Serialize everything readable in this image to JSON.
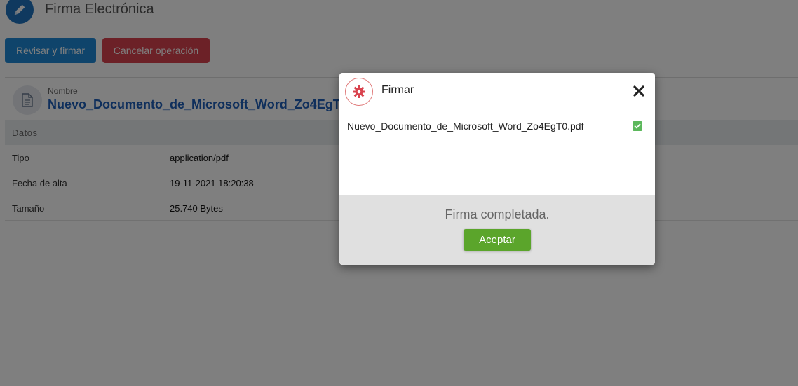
{
  "header": {
    "title": "Firma Electrónica",
    "logo_icon": "pen-icon"
  },
  "toolbar": {
    "review_sign_label": "Revisar y firmar",
    "cancel_label": "Cancelar operación"
  },
  "document": {
    "name_label": "Nombre",
    "name": "Nuevo_Documento_de_Microsoft_Word_Zo4EgT0.pdf",
    "section_title": "Datos",
    "rows": [
      {
        "key": "Tipo",
        "value": "application/pdf"
      },
      {
        "key": "Fecha de alta",
        "value": "19-11-2021 18:20:38"
      },
      {
        "key": "Tamaño",
        "value": "25.740 Bytes"
      }
    ]
  },
  "modal": {
    "title": "Firmar",
    "icon": "gear-icon",
    "file_name": "Nuevo_Documento_de_Microsoft_Word_Zo4EgT0.pdf",
    "status": "Firma completada.",
    "accept_label": "Aceptar"
  },
  "colors": {
    "primary": "#1e88d6",
    "danger": "#d9434e",
    "success": "#5ba52b",
    "link": "#1f5fb8"
  }
}
